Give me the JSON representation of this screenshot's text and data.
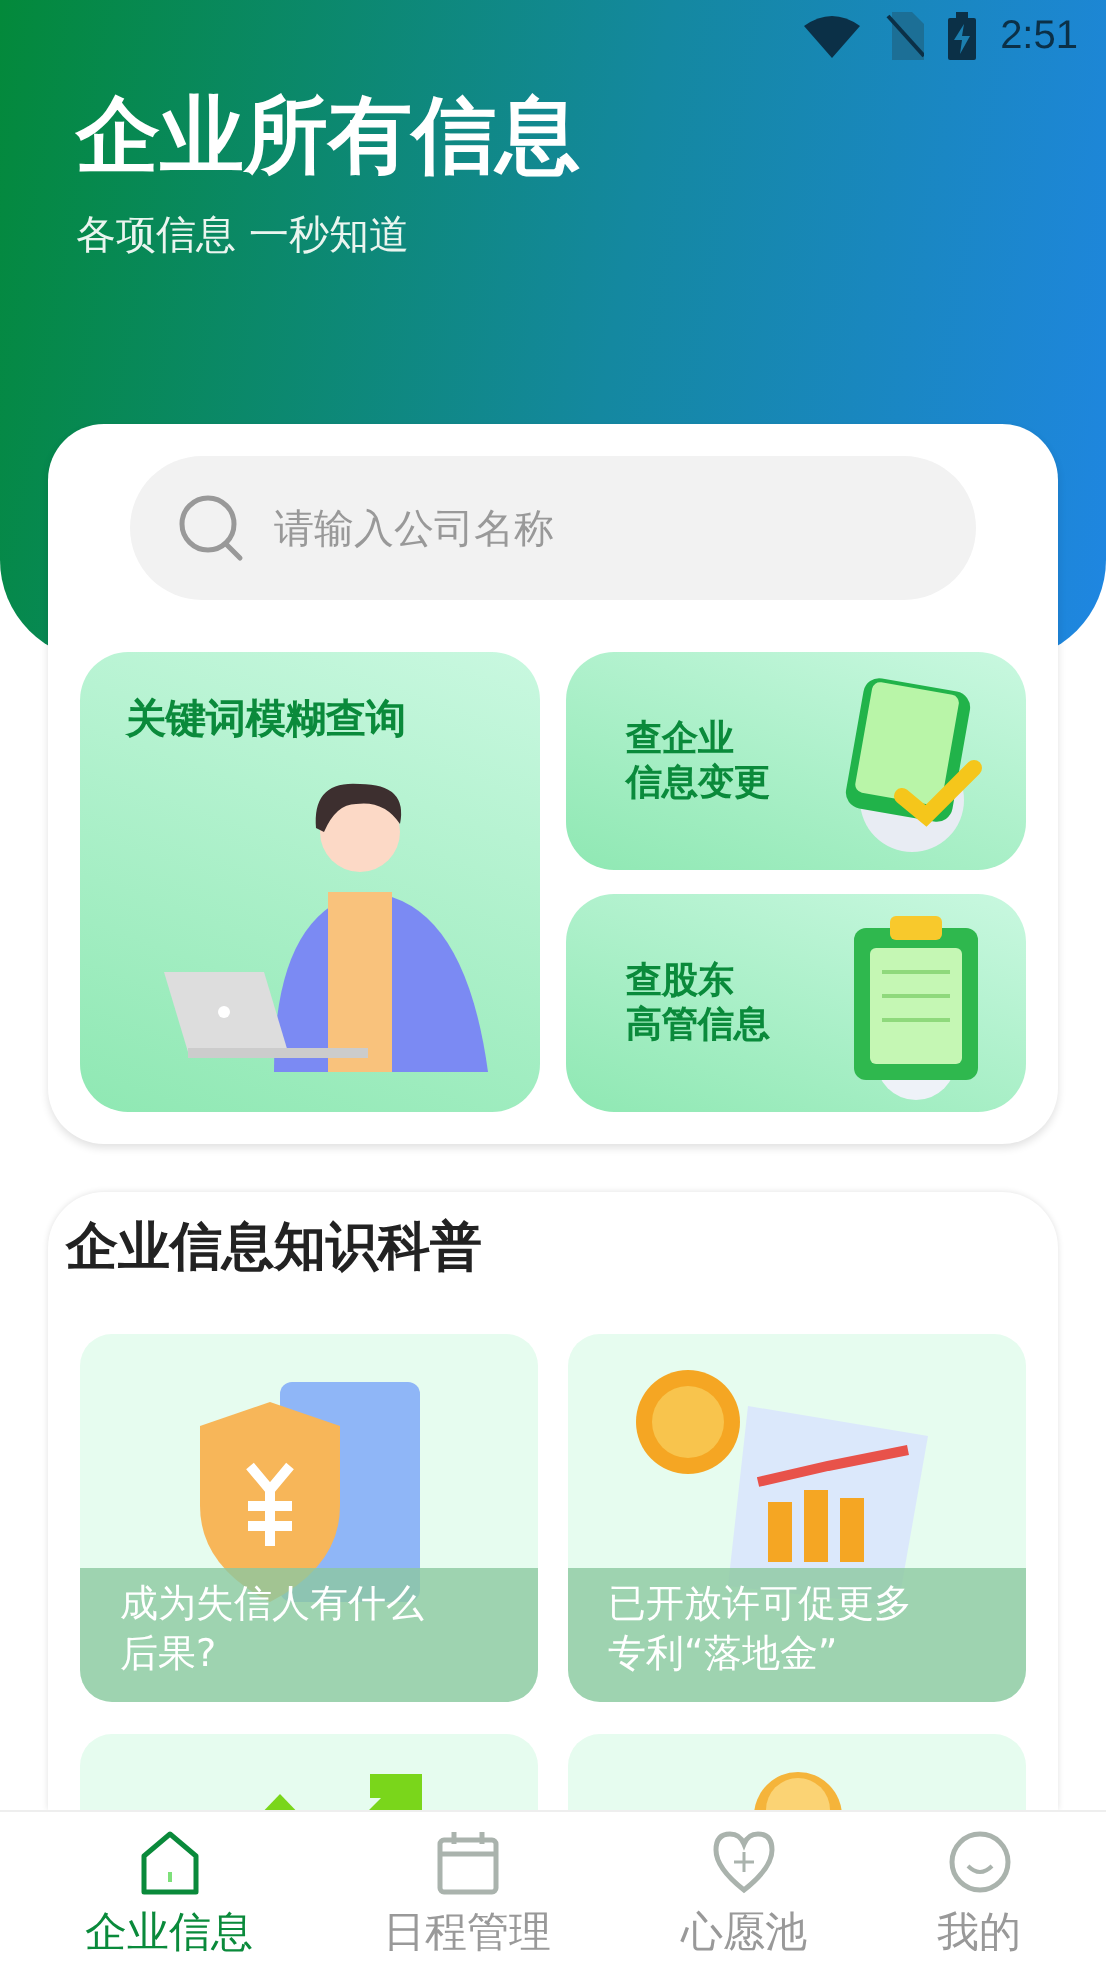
{
  "status_bar": {
    "time": "2:51"
  },
  "header": {
    "title": "企业所有信息",
    "subtitle": "各项信息 一秒知道"
  },
  "search": {
    "placeholder": "请输入公司名称"
  },
  "quick_links": [
    {
      "kind": "person",
      "label": "关键词模糊查询"
    },
    {
      "kind": "check",
      "label_lines": [
        "查企业",
        "信息变更"
      ]
    },
    {
      "kind": "clipboard",
      "label_lines": [
        "查股东",
        "高管信息"
      ]
    }
  ],
  "section": {
    "title": "企业信息知识科普"
  },
  "articles": [
    {
      "kind": "shield",
      "title": "成为失信人有什么后果?"
    },
    {
      "kind": "chart",
      "title": "已开放许可促更多专利“落地金”"
    },
    {
      "kind": "arrows"
    },
    {
      "kind": "coin"
    }
  ],
  "tabs": [
    {
      "kind": "home",
      "label": "企业信息",
      "selected": true
    },
    {
      "kind": "calendar",
      "label": "日程管理",
      "selected": false
    },
    {
      "kind": "heart",
      "label": "心愿池",
      "selected": false
    },
    {
      "kind": "smile",
      "label": "我的",
      "selected": false
    }
  ]
}
